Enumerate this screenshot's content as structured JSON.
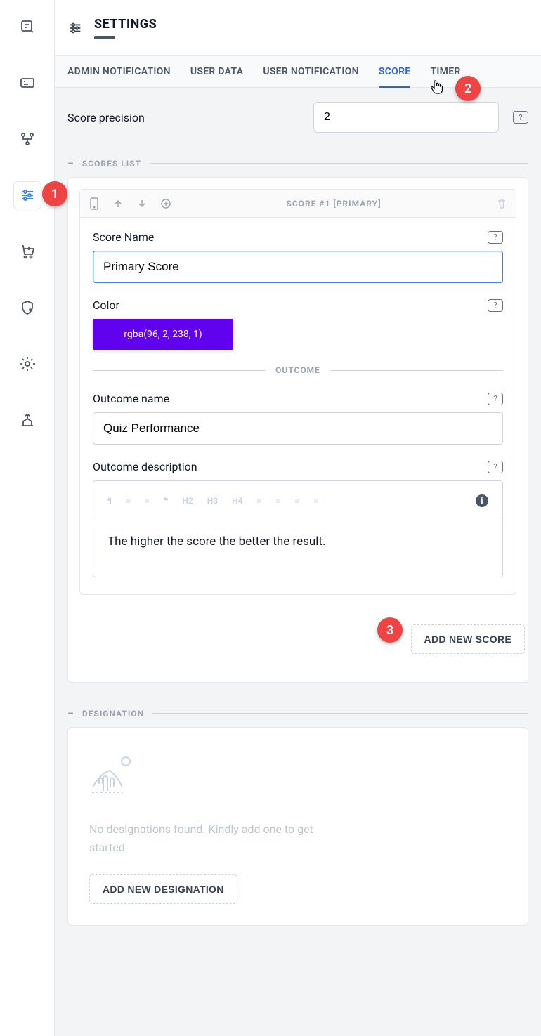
{
  "header": {
    "title": "SETTINGS"
  },
  "tabs": [
    {
      "label": "ADMIN NOTIFICATION",
      "active": false
    },
    {
      "label": "USER DATA",
      "active": false
    },
    {
      "label": "USER NOTIFICATION",
      "active": false
    },
    {
      "label": "SCORE",
      "active": true
    },
    {
      "label": "TIMER",
      "active": false
    }
  ],
  "precision": {
    "label": "Score precision",
    "value": "2"
  },
  "sections": {
    "scores_list": "SCORES LIST",
    "outcome": "OUTCOME",
    "designation": "DESIGNATION"
  },
  "score_card": {
    "toolbar_title": "SCORE  #1 [PRIMARY]",
    "name_label": "Score Name",
    "name_value": "Primary Score",
    "color_label": "Color",
    "color_value": "rgba(96, 2, 238, 1)",
    "color_hex": "#6002ee",
    "outcome_name_label": "Outcome name",
    "outcome_name_value": "Quiz Performance",
    "outcome_desc_label": "Outcome description",
    "outcome_desc_value": "The higher the score the better the result."
  },
  "rte_toolbar": [
    "¶",
    "≡",
    "≡",
    "❝",
    "H2",
    "H3",
    "H4",
    "≡",
    "≡",
    "≡",
    "≡"
  ],
  "buttons": {
    "add_score": "ADD NEW SCORE",
    "add_designation": "ADD NEW DESIGNATION"
  },
  "designation_empty": "No designations found. Kindly add one to get started",
  "annotations": {
    "b1": "1",
    "b2": "2",
    "b3": "3"
  }
}
